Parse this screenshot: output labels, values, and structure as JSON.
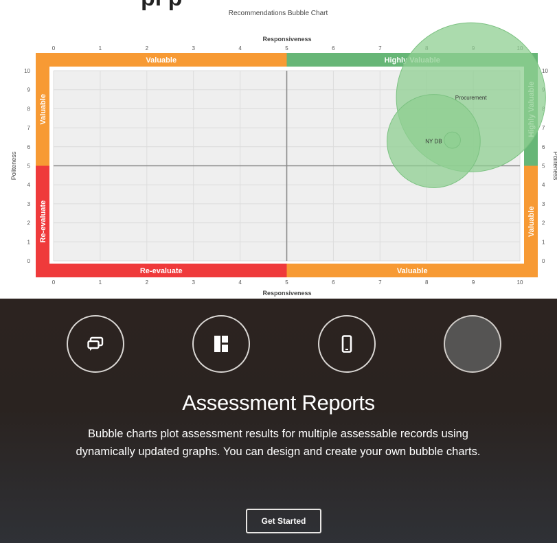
{
  "header": {
    "partial_title": "pl  p"
  },
  "chart_data": {
    "type": "scatter",
    "title": "Recommendations Bubble Chart",
    "xlabel": "Responsiveness",
    "ylabel": "Politeness",
    "xlim": [
      0,
      10
    ],
    "ylim": [
      0,
      10
    ],
    "x_ticks": [
      "0",
      "1",
      "2",
      "3",
      "4",
      "5",
      "6",
      "7",
      "8",
      "9",
      "10"
    ],
    "y_ticks": [
      "0",
      "1",
      "2",
      "3",
      "4",
      "5",
      "6",
      "7",
      "8",
      "9",
      "10"
    ],
    "grid": true,
    "quadrants": {
      "top_left": "Valuable",
      "top_right": "Highly Valuable",
      "left_upper": "Valuable",
      "left_lower": "Re-evaluate",
      "right_upper": "Highly Valuable",
      "right_lower": "Valuable",
      "bottom_left": "Re-evaluate",
      "bottom_right": "Valuable"
    },
    "colors": {
      "green": "#67b677",
      "orange": "#f79a34",
      "red": "#ef3a3b",
      "plot_bg": "#efefef",
      "bubble": "#8fcf92"
    },
    "points": [
      {
        "label": "Procurement",
        "x": 8.95,
        "y": 8.6,
        "size": 3.2
      },
      {
        "label": "NY DB",
        "x": 8.15,
        "y": 6.3,
        "size": 2.0
      },
      {
        "label": "",
        "x": 8.55,
        "y": 6.35,
        "size": 0.35
      }
    ]
  },
  "promo": {
    "icons": [
      "chat-icon",
      "layout-icon",
      "mobile-icon",
      "blank-icon"
    ],
    "headline": "Assessment Reports",
    "description": "Bubble charts plot assessment results for multiple assessable records using dynamically updated graphs. You can design and create your own bubble charts.",
    "cta_label": "Get Started"
  }
}
